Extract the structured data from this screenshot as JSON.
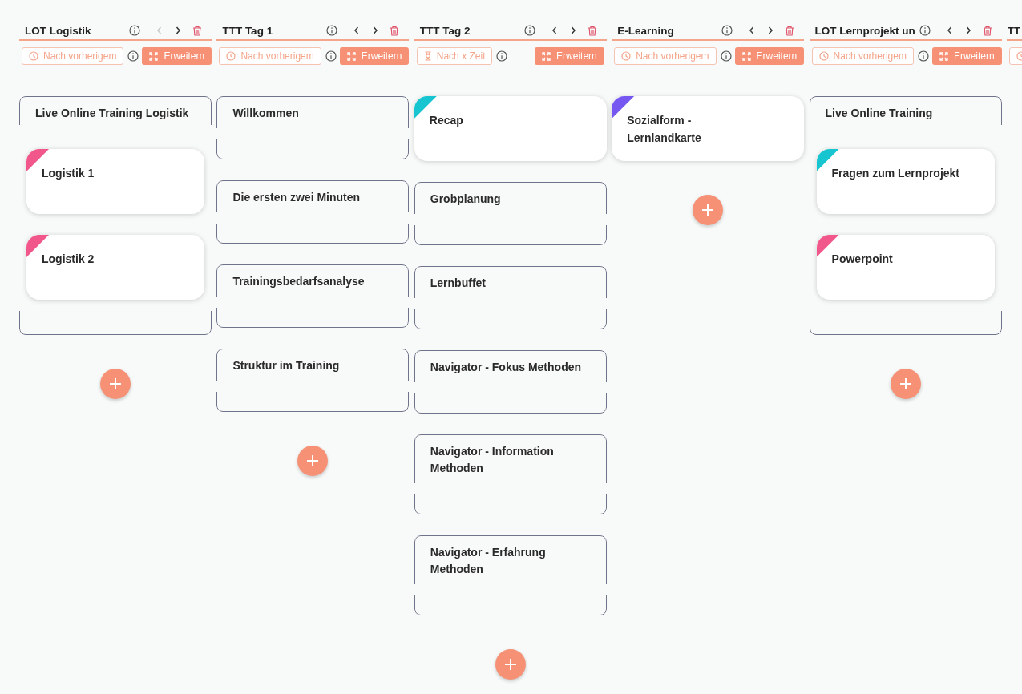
{
  "columns": [
    {
      "kind": "full",
      "title": "LOT Logistik",
      "prev_disabled": true,
      "mode": {
        "kind": "after_previous",
        "label": "Nach vorherigem"
      },
      "expand_label": "Erweitern",
      "items": [
        {
          "kind": "group",
          "title": "Live Online Training Logistik",
          "children": [
            {
              "kind": "card",
              "title": "Logistik 1",
              "color": "#f2578b"
            },
            {
              "kind": "card",
              "title": "Logistik 2",
              "color": "#f2578b"
            }
          ]
        }
      ]
    },
    {
      "kind": "full",
      "title": "TTT Tag 1",
      "prev_disabled": false,
      "mode": {
        "kind": "after_previous",
        "label": "Nach vorherigem"
      },
      "expand_label": "Erweitern",
      "items": [
        {
          "kind": "box",
          "title": "Willkommen"
        },
        {
          "kind": "box",
          "title": "Die ersten zwei Minuten"
        },
        {
          "kind": "box",
          "title": "Trainingsbedarfsanalyse"
        },
        {
          "kind": "box",
          "title": "Struktur im Training"
        }
      ]
    },
    {
      "kind": "full",
      "title": "TTT Tag 2",
      "prev_disabled": false,
      "mode": {
        "kind": "after_time",
        "label": "Nach x Zeit"
      },
      "expand_label": "Erweitern",
      "items": [
        {
          "kind": "card",
          "title": "Recap",
          "color": "#16c5d0"
        },
        {
          "kind": "box",
          "title": "Grobplanung"
        },
        {
          "kind": "box",
          "title": "Lernbuffet"
        },
        {
          "kind": "box",
          "title": "Navigator - Fokus Methoden"
        },
        {
          "kind": "box",
          "title": "Navigator - Information Methoden"
        },
        {
          "kind": "box",
          "title": "Navigator - Erfahrung Methoden"
        }
      ]
    },
    {
      "kind": "full",
      "title": "E-Learning",
      "prev_disabled": false,
      "mode": {
        "kind": "after_previous",
        "label": "Nach vorherigem"
      },
      "expand_label": "Erweitern",
      "items": [
        {
          "kind": "card",
          "title": "Sozialform - Lernlandkarte",
          "color": "#7657f2"
        }
      ]
    },
    {
      "kind": "full",
      "title": "LOT Lernprojekt un",
      "prev_disabled": false,
      "mode": {
        "kind": "after_previous",
        "label": "Nach vorherigem"
      },
      "expand_label": "Erweitern",
      "items": [
        {
          "kind": "group",
          "title": "Live Online Training",
          "children": [
            {
              "kind": "card",
              "title": "Fragen zum Lernprojekt",
              "color": "#16c5d0"
            },
            {
              "kind": "card",
              "title": "Powerpoint",
              "color": "#f2578b"
            }
          ]
        }
      ]
    },
    {
      "kind": "partial",
      "title": "TT",
      "mode": {
        "kind": "after_previous"
      }
    }
  ]
}
